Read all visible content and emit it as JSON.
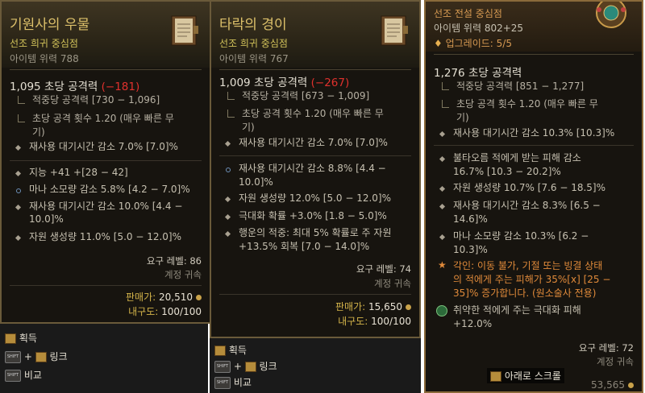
{
  "card1": {
    "title": "기원사의 우물",
    "subtitle": "선조 희귀 중심점",
    "power": "아이템 위력 788",
    "main_value": "1,095 초당 공격력",
    "main_delta": "(−181)",
    "sub1": "적중당 공격력 [730 − 1,096]",
    "sub2_a": "초당 공격 횟수 1.20 (매우 빠른 무",
    "sub2_b": "기)",
    "implicit": "재사용 대기시간 감소 7.0% [7.0]%",
    "affixes": [
      {
        "a": "지능 +41 +[28 − 42]",
        "b": ""
      },
      {
        "a": "마나 소모량 감소 5.8% [4.2 − 7.0]%",
        "b": ""
      },
      {
        "a": "재사용 대기시간 감소 10.0% [4.4 −",
        "b": "10.0]%"
      },
      {
        "a": "자원 생성량 11.0% [5.0 − 12.0]%",
        "b": ""
      }
    ],
    "req_level": "요구 레벨: 86",
    "bound": "계정 귀속",
    "sell_label": "판매가:",
    "sell_value": "20,510",
    "dur_label": "내구도:",
    "dur_value": "100/100"
  },
  "card2": {
    "title": "타락의 경이",
    "subtitle": "선조 희귀 중심점",
    "power": "아이템 위력 767",
    "main_value": "1,009 초당 공격력",
    "main_delta": "(−267)",
    "sub1": "적중당 공격력 [673 − 1,009]",
    "sub2_a": "초당 공격 횟수 1.20 (매우 빠른 무",
    "sub2_b": "기)",
    "implicit": "재사용 대기시간 감소 7.0% [7.0]%",
    "affixes": [
      {
        "a": "재사용 대기시간 감소 8.8% [4.4 −",
        "b": "10.0]%"
      },
      {
        "a": "자원 생성량 12.0% [5.0 − 12.0]%",
        "b": ""
      },
      {
        "a": "극대화 확률 +3.0% [1.8 − 5.0]%",
        "b": ""
      },
      {
        "a": "행운의 적중: 최대 5% 확률로 주 자원",
        "b": "+13.5% 회복 [7.0 − 14.0]%"
      }
    ],
    "req_level": "요구 레벨: 74",
    "bound": "계정 귀속",
    "sell_label": "판매가:",
    "sell_value": "15,650",
    "dur_label": "내구도:",
    "dur_value": "100/100"
  },
  "card3": {
    "title": "선조 전설 중심점",
    "power": "아이템 위력 802+25",
    "upgrade": "업그레이드: 5/5",
    "main_value": "1,276 초당 공격력",
    "sub1": "적중당 공격력 [851 − 1,277]",
    "sub2_a": "초당 공격 횟수 1.20 (매우 빠른 무",
    "sub2_b": "기)",
    "implicit": "재사용 대기시간 감소 10.3% [10.3]%",
    "affixes": [
      {
        "a": "불타오름 적에게 받는 피해 감소",
        "b": "16.7% [10.3 − 20.2]%"
      },
      {
        "a": "자원 생성량 10.7% [7.6 − 18.5]%",
        "b": ""
      },
      {
        "a": "재사용 대기시간 감소 8.3% [6.5 −",
        "b": "14.6]%"
      },
      {
        "a": "마나 소모량 감소 10.3% [6.2 −",
        "b": "10.3]%"
      }
    ],
    "aspect_a": "각인: 이동 불가, 기절 또는 빙결 상태",
    "aspect_b": "의 적에게 주는 피해가 35%[x] [25 −",
    "aspect_c": "35]% 증가합니다. (원소술사 전용)",
    "gem_a": "취약한 적에게 주는 극대화 피해",
    "gem_b": "+12.0%",
    "req_level": "요구 레벨: 72",
    "bound": "계정 귀속",
    "scroll_hint": "아래로 스크롤",
    "sell_value_partial": "53,565"
  },
  "footer": {
    "acquire": "획득",
    "link": "링크",
    "compare": "비교",
    "plus": "+",
    "shift": "SHIFT"
  },
  "colors": {
    "gold": "#dcc06a",
    "legendary_orange": "#d79a52",
    "rare_yellow": "#d2c35a",
    "negative_red": "#e0312d",
    "aspect_orange": "#e08a3a"
  }
}
